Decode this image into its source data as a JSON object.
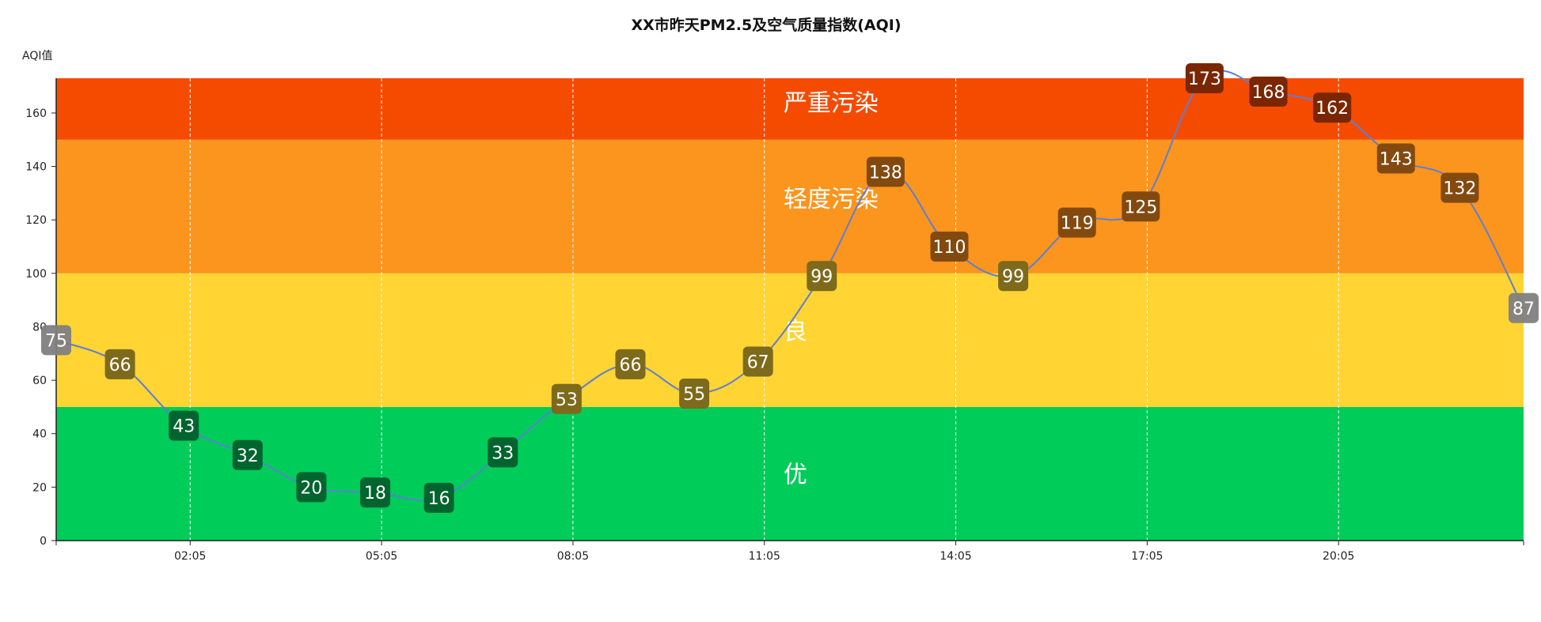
{
  "chart_data": {
    "type": "line",
    "title": "XX市昨天PM2.5及空气质量指数(AQI)",
    "ylabel": "AQI值",
    "xlabel": "",
    "ylim": [
      0,
      173
    ],
    "y_ticks": [
      0,
      20,
      40,
      60,
      80,
      100,
      120,
      140,
      160
    ],
    "x_tick_labels": [
      "02:05",
      "05:05",
      "08:05",
      "11:05",
      "14:05",
      "17:05",
      "20:05"
    ],
    "x_tick_positions": [
      2.1,
      5.1,
      8.1,
      11.1,
      14.1,
      17.1,
      20.1
    ],
    "grid": "vertical dashed",
    "line_color": "#5b7fd6",
    "bands": [
      {
        "name": "优",
        "from": 0,
        "to": 50,
        "color": "#00cc5a"
      },
      {
        "name": "良",
        "from": 50,
        "to": 100,
        "color": "#ffd433"
      },
      {
        "name": "轻度污染",
        "from": 100,
        "to": 150,
        "color": "#fc951d"
      },
      {
        "name": "严重污染",
        "from": 150,
        "to": 173,
        "color": "#f54b00"
      }
    ],
    "series": [
      {
        "x": [
          0,
          1,
          2,
          3,
          4,
          5,
          6,
          7,
          8,
          9,
          10,
          11,
          12,
          13,
          14,
          15,
          16,
          17,
          18,
          19,
          20,
          21,
          22,
          23
        ],
        "values": [
          75,
          66,
          43,
          32,
          20,
          18,
          16,
          33,
          53,
          66,
          55,
          67,
          99,
          138,
          110,
          99,
          119,
          125,
          173,
          168,
          162,
          143,
          132,
          87
        ]
      }
    ]
  }
}
